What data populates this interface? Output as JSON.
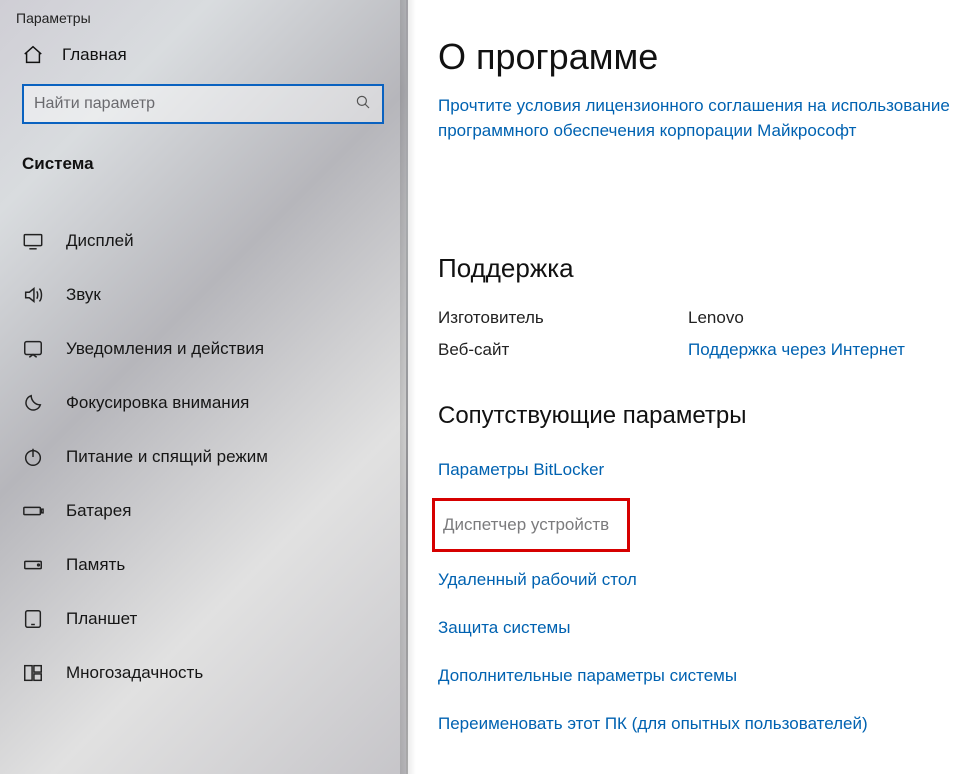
{
  "window_title": "Параметры",
  "home_label": "Главная",
  "search": {
    "placeholder": "Найти параметр"
  },
  "section_label": "Система",
  "nav": [
    {
      "label": "Дисплей"
    },
    {
      "label": "Звук"
    },
    {
      "label": "Уведомления и действия"
    },
    {
      "label": "Фокусировка внимания"
    },
    {
      "label": "Питание и спящий режим"
    },
    {
      "label": "Батарея"
    },
    {
      "label": "Память"
    },
    {
      "label": "Планшет"
    },
    {
      "label": "Многозадачность"
    }
  ],
  "page": {
    "title": "О программе",
    "license_link": "Прочтите условия лицензионного соглашения на использование программного обеспечения корпорации Майкрософт",
    "support": {
      "heading": "Поддержка",
      "rows": {
        "manufacturer_label": "Изготовитель",
        "manufacturer_value": "Lenovo",
        "website_label": "Веб-сайт",
        "website_value": "Поддержка через Интернет"
      }
    },
    "related": {
      "heading": "Сопутствующие параметры",
      "bitlocker": "Параметры BitLocker",
      "device_manager": "Диспетчер устройств",
      "remote_desktop": "Удаленный рабочий стол",
      "system_protection": "Защита системы",
      "advanced": "Дополнительные параметры системы",
      "rename_pc": "Переименовать этот ПК (для опытных пользователей)"
    }
  }
}
